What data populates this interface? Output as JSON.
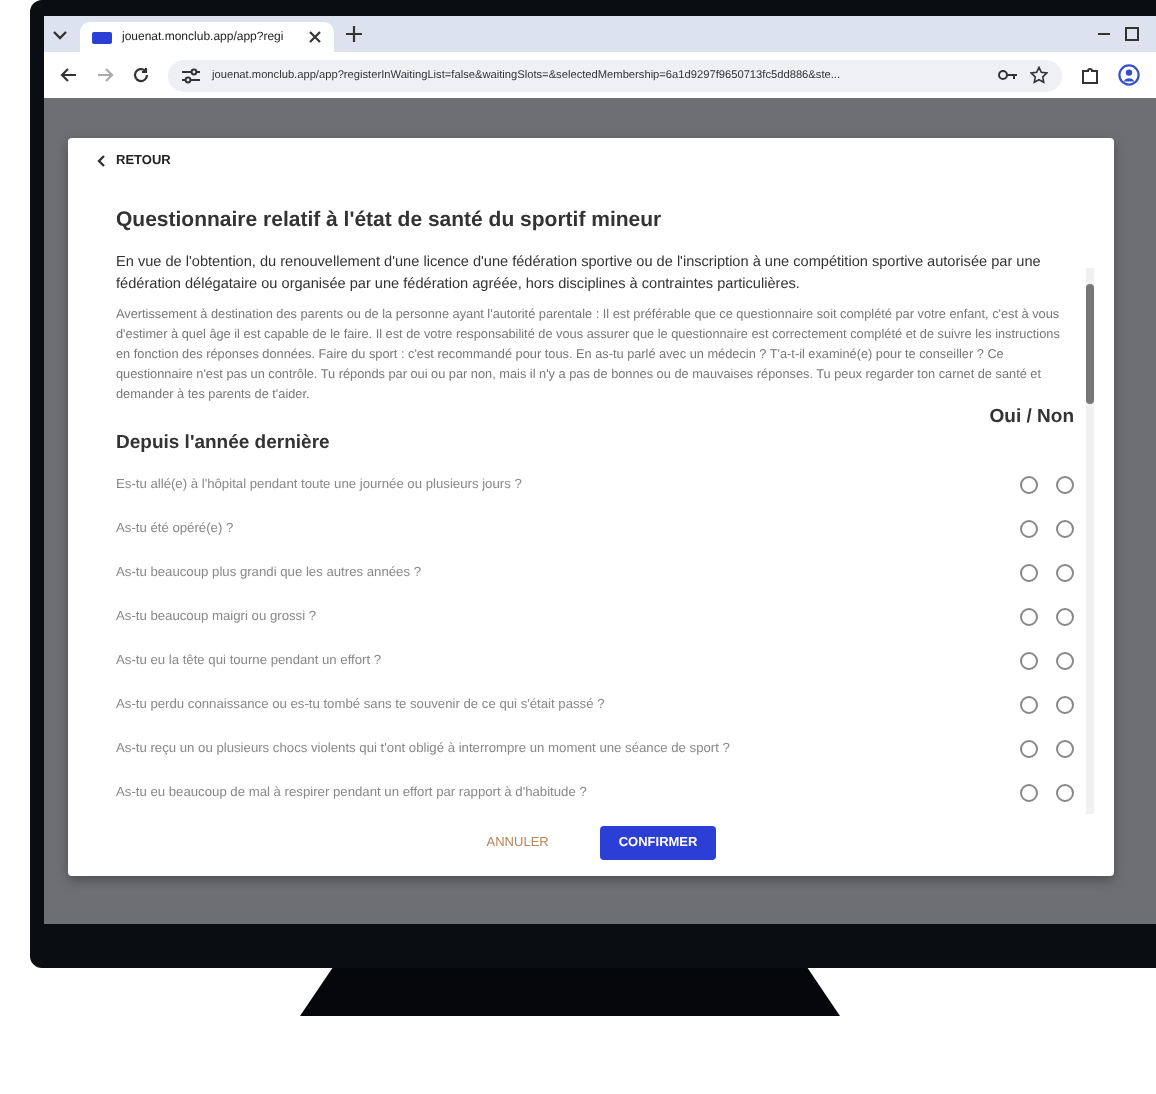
{
  "browser": {
    "tab_title": "jouenat.monclub.app/app?regi",
    "url": "jouenat.monclub.app/app?registerInWaitingList=false&waitingSlots=&selectedMembership=6a1d9297f9650713fc5dd886&ste..."
  },
  "modal": {
    "back": "RETOUR",
    "title": "Questionnaire relatif à l'état de santé du sportif mineur",
    "intro": "En vue de l'obtention, du renouvellement d'une licence d'une fédération sportive ou de l'inscription à une compétition sportive autorisée par une fédération délégataire ou organisée par une fédération agréée, hors disciplines à contraintes particulières.",
    "warning": "Avertissement à destination des parents ou de la personne ayant l'autorité parentale : Il est préférable que ce questionnaire soit complété par votre enfant, c'est à vous d'estimer à quel âge il est capable de le faire. Il est de votre responsabilité de vous assurer que le questionnaire est correctement complété et de suivre les instructions en fonction des réponses données. Faire du sport : c'est recommandé pour tous. En as-tu parlé avec un médecin ? T'a-t-il examiné(e) pour te conseiller ? Ce questionnaire n'est pas un contrôle. Tu réponds par oui ou par non, mais il n'y a pas de bonnes ou de mauvaises réponses. Tu peux regarder ton carnet de santé et demander à tes parents de t'aider.",
    "answer_header": "Oui / Non",
    "section": "Depuis l'année dernière",
    "questions": [
      {
        "text": "Es-tu allé(e) à l'hôpital pendant toute une journée ou plusieurs jours ?",
        "oui_selected": false,
        "non_selected": false
      },
      {
        "text": "As-tu été opéré(e) ?",
        "oui_selected": false,
        "non_selected": false
      },
      {
        "text": "As-tu beaucoup plus grandi que les autres années ?",
        "oui_selected": false,
        "non_selected": false
      },
      {
        "text": "As-tu beaucoup maigri ou grossi ?",
        "oui_selected": false,
        "non_selected": false
      },
      {
        "text": "As-tu eu la tête qui tourne pendant un effort ?",
        "oui_selected": false,
        "non_selected": false
      },
      {
        "text": "As-tu perdu connaissance ou es-tu tombé sans te souvenir de ce qui s'était passé ?",
        "oui_selected": false,
        "non_selected": false
      },
      {
        "text": "As-tu reçu un ou plusieurs chocs violents qui t'ont obligé à interrompre un moment une séance de sport ?",
        "oui_selected": false,
        "non_selected": false
      },
      {
        "text": "As-tu eu beaucoup de mal à respirer pendant un effort par rapport à d'habitude ?",
        "oui_selected": false,
        "non_selected": false
      }
    ],
    "cancel": "ANNULER",
    "confirm": "CONFIRMER"
  }
}
